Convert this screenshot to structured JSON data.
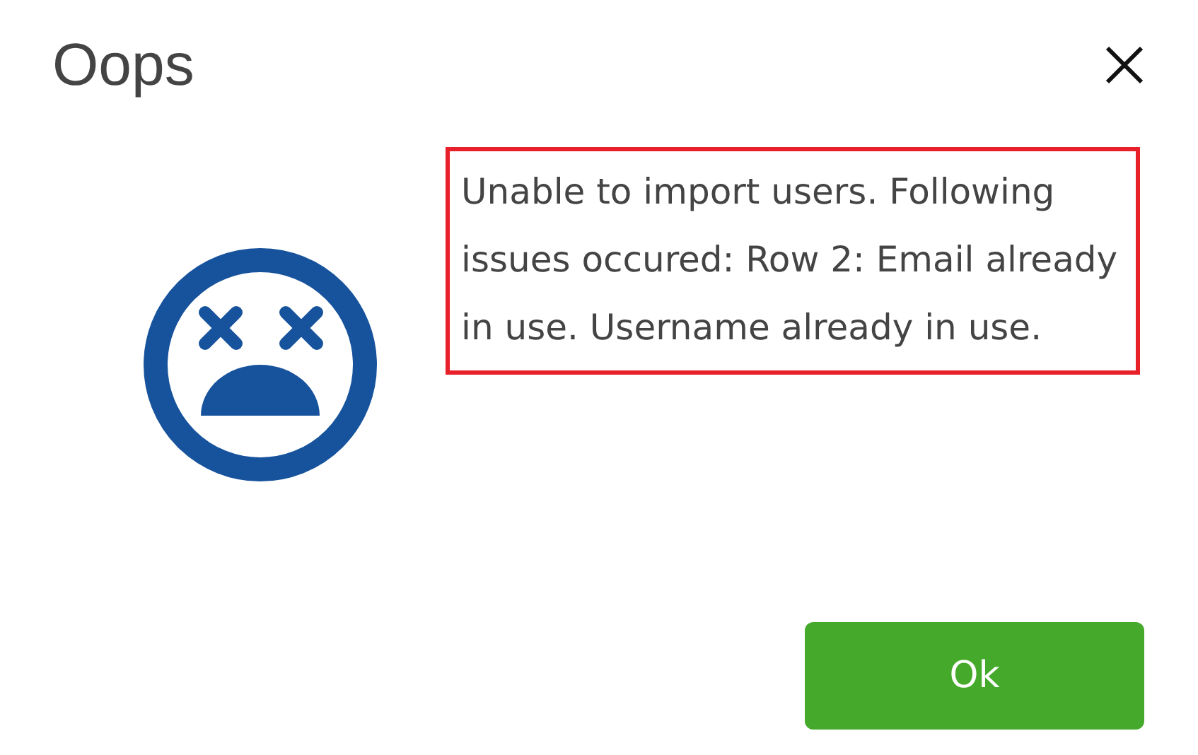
{
  "dialog": {
    "title": "Oops",
    "message": "Unable to import users. Following issues occured: Row 2: Email already in use. Username already in use.",
    "buttons": [
      {
        "label": "Ok",
        "kind": "primary"
      }
    ]
  }
}
